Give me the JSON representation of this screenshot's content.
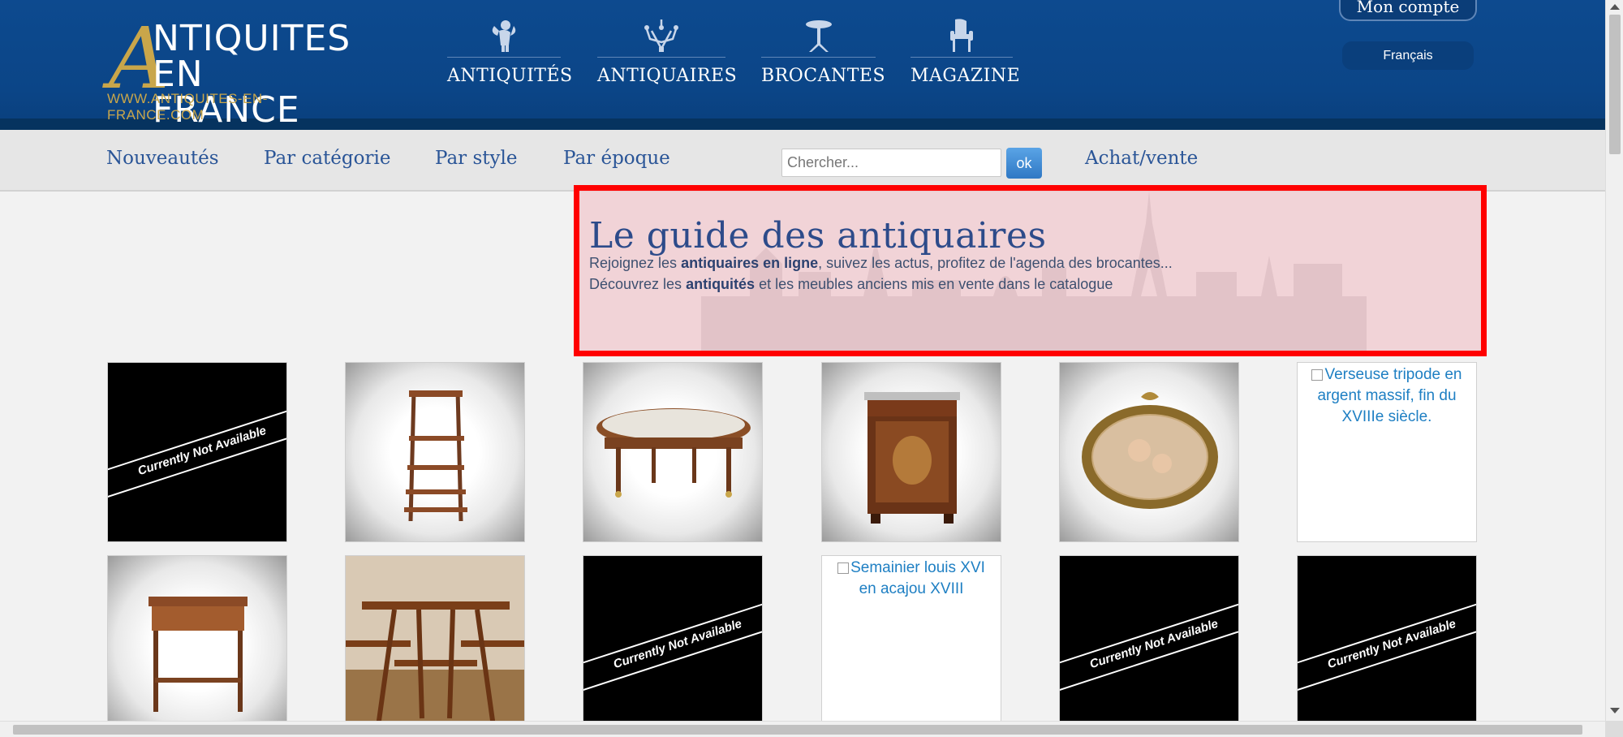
{
  "brand": {
    "logo_letter": "A",
    "logo_line1": "NTIQUITES",
    "logo_line2": "EN FRANCE",
    "url": "WWW.ANTIQUITES-EN-FRANCE.COM"
  },
  "top_nav": [
    {
      "label": "ANTIQUITÉS",
      "icon": "cherub-icon"
    },
    {
      "label": "ANTIQUAIRES",
      "icon": "chandelier-icon"
    },
    {
      "label": "BROCANTES",
      "icon": "pedestal-table-icon"
    },
    {
      "label": "MAGAZINE",
      "icon": "armchair-icon"
    }
  ],
  "account": {
    "label": "Mon compte",
    "language": "Français"
  },
  "sub_nav": {
    "items": [
      "Nouveautés",
      "Par catégorie",
      "Par style",
      "Par époque"
    ],
    "search_placeholder": "Chercher...",
    "search_button": "ok",
    "buy_sell": "Achat/vente"
  },
  "guide": {
    "title": "Le guide des antiquaires",
    "line1_a": "Rejoignez les ",
    "line1_b": "antiquaires en ligne",
    "line1_c": ", suivez les actus, profitez de l'agenda des brocantes...",
    "line2_a": "Découvrez les ",
    "line2_b": "antiquités",
    "line2_c": " et les meubles anciens mis en vente dans le catalogue"
  },
  "products": {
    "row1": [
      {
        "type": "not-available",
        "text": "Currently Not Available"
      },
      {
        "type": "image",
        "subject": "etagere-stand"
      },
      {
        "type": "image",
        "subject": "oval-table"
      },
      {
        "type": "image",
        "subject": "cabinet"
      },
      {
        "type": "image",
        "subject": "oval-painting"
      },
      {
        "type": "broken",
        "alt": "Verseuse tripode en argent massif, fin du XVIIIe siècle."
      }
    ],
    "row2": [
      {
        "type": "image",
        "subject": "side-table"
      },
      {
        "type": "image",
        "subject": "tiered-table"
      },
      {
        "type": "not-available",
        "text": "Currently Not Available"
      },
      {
        "type": "broken",
        "alt": "Semainier louis XVI en acajou XVIII"
      },
      {
        "type": "not-available",
        "text": "Currently Not Available"
      },
      {
        "type": "not-available",
        "text": "Currently Not Available"
      }
    ]
  },
  "colors": {
    "header_blue": "#0d4a8f",
    "gold": "#c9a64a",
    "link_blue": "#2a5597",
    "highlight_red": "#ff0000"
  }
}
